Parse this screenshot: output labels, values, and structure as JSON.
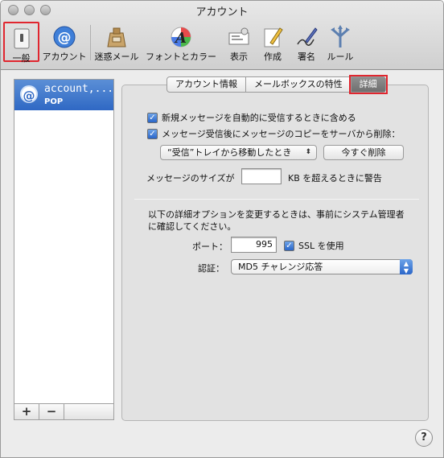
{
  "window": {
    "title": "アカウント"
  },
  "toolbar": {
    "items": [
      {
        "label": "一般",
        "icon": "general-switch-icon"
      },
      {
        "label": "アカウント",
        "icon": "at-sign-icon"
      },
      {
        "label": "迷惑メール",
        "icon": "junk-mail-bag-icon"
      },
      {
        "label": "フォントとカラー",
        "icon": "fonts-colors-icon"
      },
      {
        "label": "表示",
        "icon": "viewing-icon"
      },
      {
        "label": "作成",
        "icon": "compose-pencil-icon"
      },
      {
        "label": "署名",
        "icon": "signature-pen-icon"
      },
      {
        "label": "ルール",
        "icon": "rules-icon"
      }
    ]
  },
  "sidebar": {
    "account": {
      "name": "account,...",
      "type": "POP",
      "icon": "at-sign-icon"
    },
    "add_label": "+",
    "remove_label": "−"
  },
  "tabs": [
    {
      "label": "アカウント情報"
    },
    {
      "label": "メールボックスの特性"
    },
    {
      "label": "詳細",
      "active": true
    }
  ],
  "advanced": {
    "include_check_label": "新規メッセージを自動的に受信するときに含める",
    "remove_copy_label": "メッセージ受信後にメッセージのコピーをサーバから削除：",
    "remove_when_value": "“受信”トレイから移動したとき",
    "remove_now_label": "今すぐ削除",
    "size_label": "メッセージのサイズが",
    "size_value": "",
    "size_suffix": "KB を超えるときに警告",
    "notice": "以下の詳細オプションを変更するときは、事前にシステム管理者に確認してください。",
    "port_label": "ポート：",
    "port_value": "995",
    "ssl_label": "SSL を使用",
    "auth_label": "認証：",
    "auth_value": "MD5 チャレンジ応答"
  },
  "help_label": "?",
  "colors": {
    "highlight": "#e0262f",
    "accent": "#2f68c4"
  }
}
